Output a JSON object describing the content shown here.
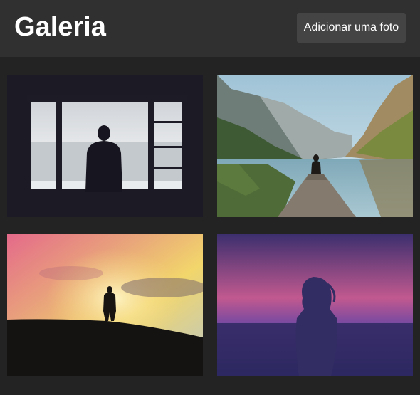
{
  "header": {
    "title": "Galeria",
    "add_button_label": "Adicionar uma foto"
  },
  "colors": {
    "page_background": "#232323",
    "header_background": "#303030",
    "button_background": "#444444",
    "text": "#ffffff"
  },
  "gallery": {
    "photos": [
      {
        "subject": "person-at-window-silhouette"
      },
      {
        "subject": "person-on-lake-pier-between-mountains"
      },
      {
        "subject": "person-on-hill-at-sunset"
      },
      {
        "subject": "woman-silhouette-purple-sky"
      }
    ]
  }
}
